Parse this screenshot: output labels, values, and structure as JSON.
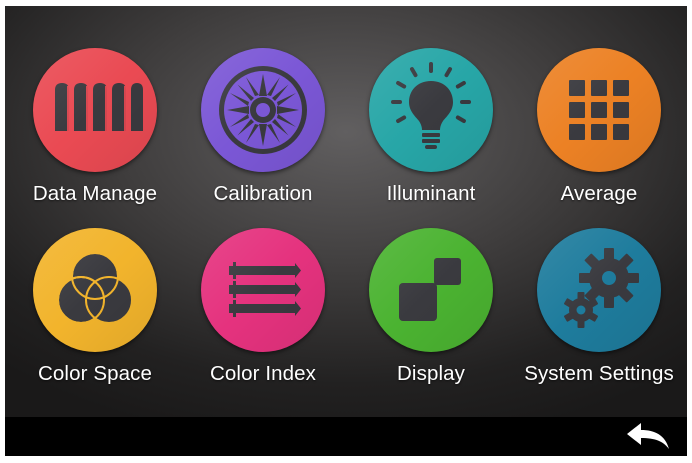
{
  "menu": {
    "items": [
      {
        "label": "Data Manage",
        "icon": "data-manage-icon",
        "color": "#ea4a53"
      },
      {
        "label": "Calibration",
        "icon": "calibration-icon",
        "color": "#7b57d6"
      },
      {
        "label": "Illuminant",
        "icon": "lightbulb-icon",
        "color": "#27a6a7"
      },
      {
        "label": "Average",
        "icon": "grid-icon",
        "color": "#ec8124"
      },
      {
        "label": "Color Space",
        "icon": "color-space-icon",
        "color": "#f2b42c"
      },
      {
        "label": "Color Index",
        "icon": "color-index-icon",
        "color": "#e5327e"
      },
      {
        "label": "Display",
        "icon": "display-icon",
        "color": "#4bb331"
      },
      {
        "label": "System Settings",
        "icon": "gears-icon",
        "color": "#1e7c9d"
      }
    ]
  },
  "footer": {
    "back_icon": "back-arrow-icon"
  },
  "colors": {
    "icon_dark": "#3a3a3f",
    "background": "#3d3b3b",
    "bar": "#000000"
  }
}
